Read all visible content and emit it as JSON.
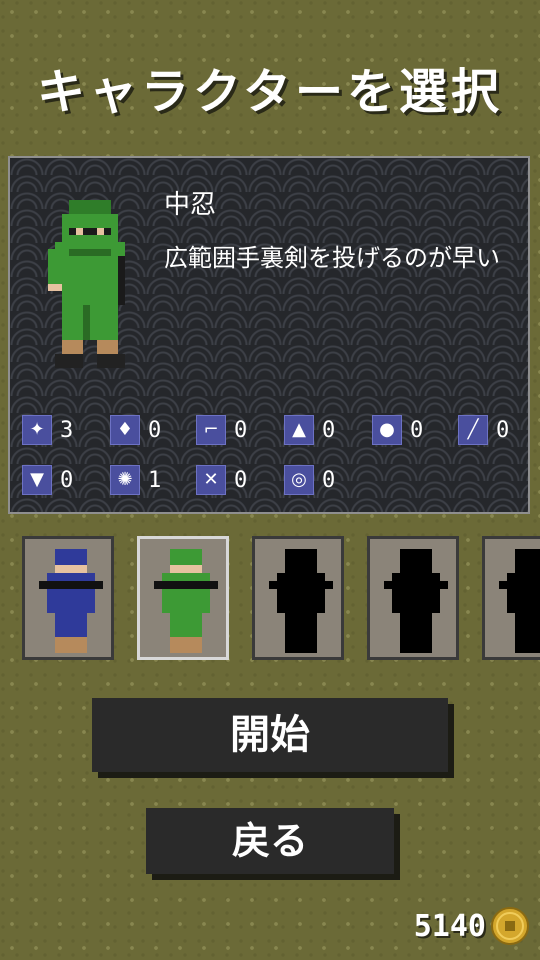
{
  "screen": {
    "title": "キャラクターを選択"
  },
  "character": {
    "name": "中忍",
    "description": "広範囲手裏剣を投げるのが早い"
  },
  "stats": [
    {
      "icon": "shuriken-icon",
      "glyph": "✦",
      "value": "3"
    },
    {
      "icon": "kunai-icon",
      "glyph": "♦",
      "value": "0"
    },
    {
      "icon": "kama-icon",
      "glyph": "⌐",
      "value": "0"
    },
    {
      "icon": "caltrop-icon",
      "glyph": "▲",
      "value": "0"
    },
    {
      "icon": "bomb-icon",
      "glyph": "●",
      "value": "0"
    },
    {
      "icon": "sword-icon",
      "glyph": "╱",
      "value": "0"
    },
    {
      "icon": "shield-icon",
      "glyph": "▼",
      "value": "0"
    },
    {
      "icon": "wheel-shuriken-icon",
      "glyph": "✺",
      "value": "1"
    },
    {
      "icon": "crossed-blades-icon",
      "glyph": "✕",
      "value": "0"
    },
    {
      "icon": "ring-icon",
      "glyph": "◎",
      "value": "0"
    }
  ],
  "roster": [
    {
      "id": "blue-ninja",
      "state": "unlocked",
      "color": "#2f3a9a"
    },
    {
      "id": "green-ninja",
      "state": "selected",
      "color": "#3d9a35"
    },
    {
      "id": "ninja-3",
      "state": "locked",
      "color": "#000000"
    },
    {
      "id": "ninja-4",
      "state": "locked",
      "color": "#000000"
    },
    {
      "id": "ninja-5",
      "state": "locked",
      "color": "#000000"
    }
  ],
  "buttons": {
    "start": "開始",
    "back": "戻る"
  },
  "wallet": {
    "coins": "5140",
    "icon": "coin-icon"
  }
}
